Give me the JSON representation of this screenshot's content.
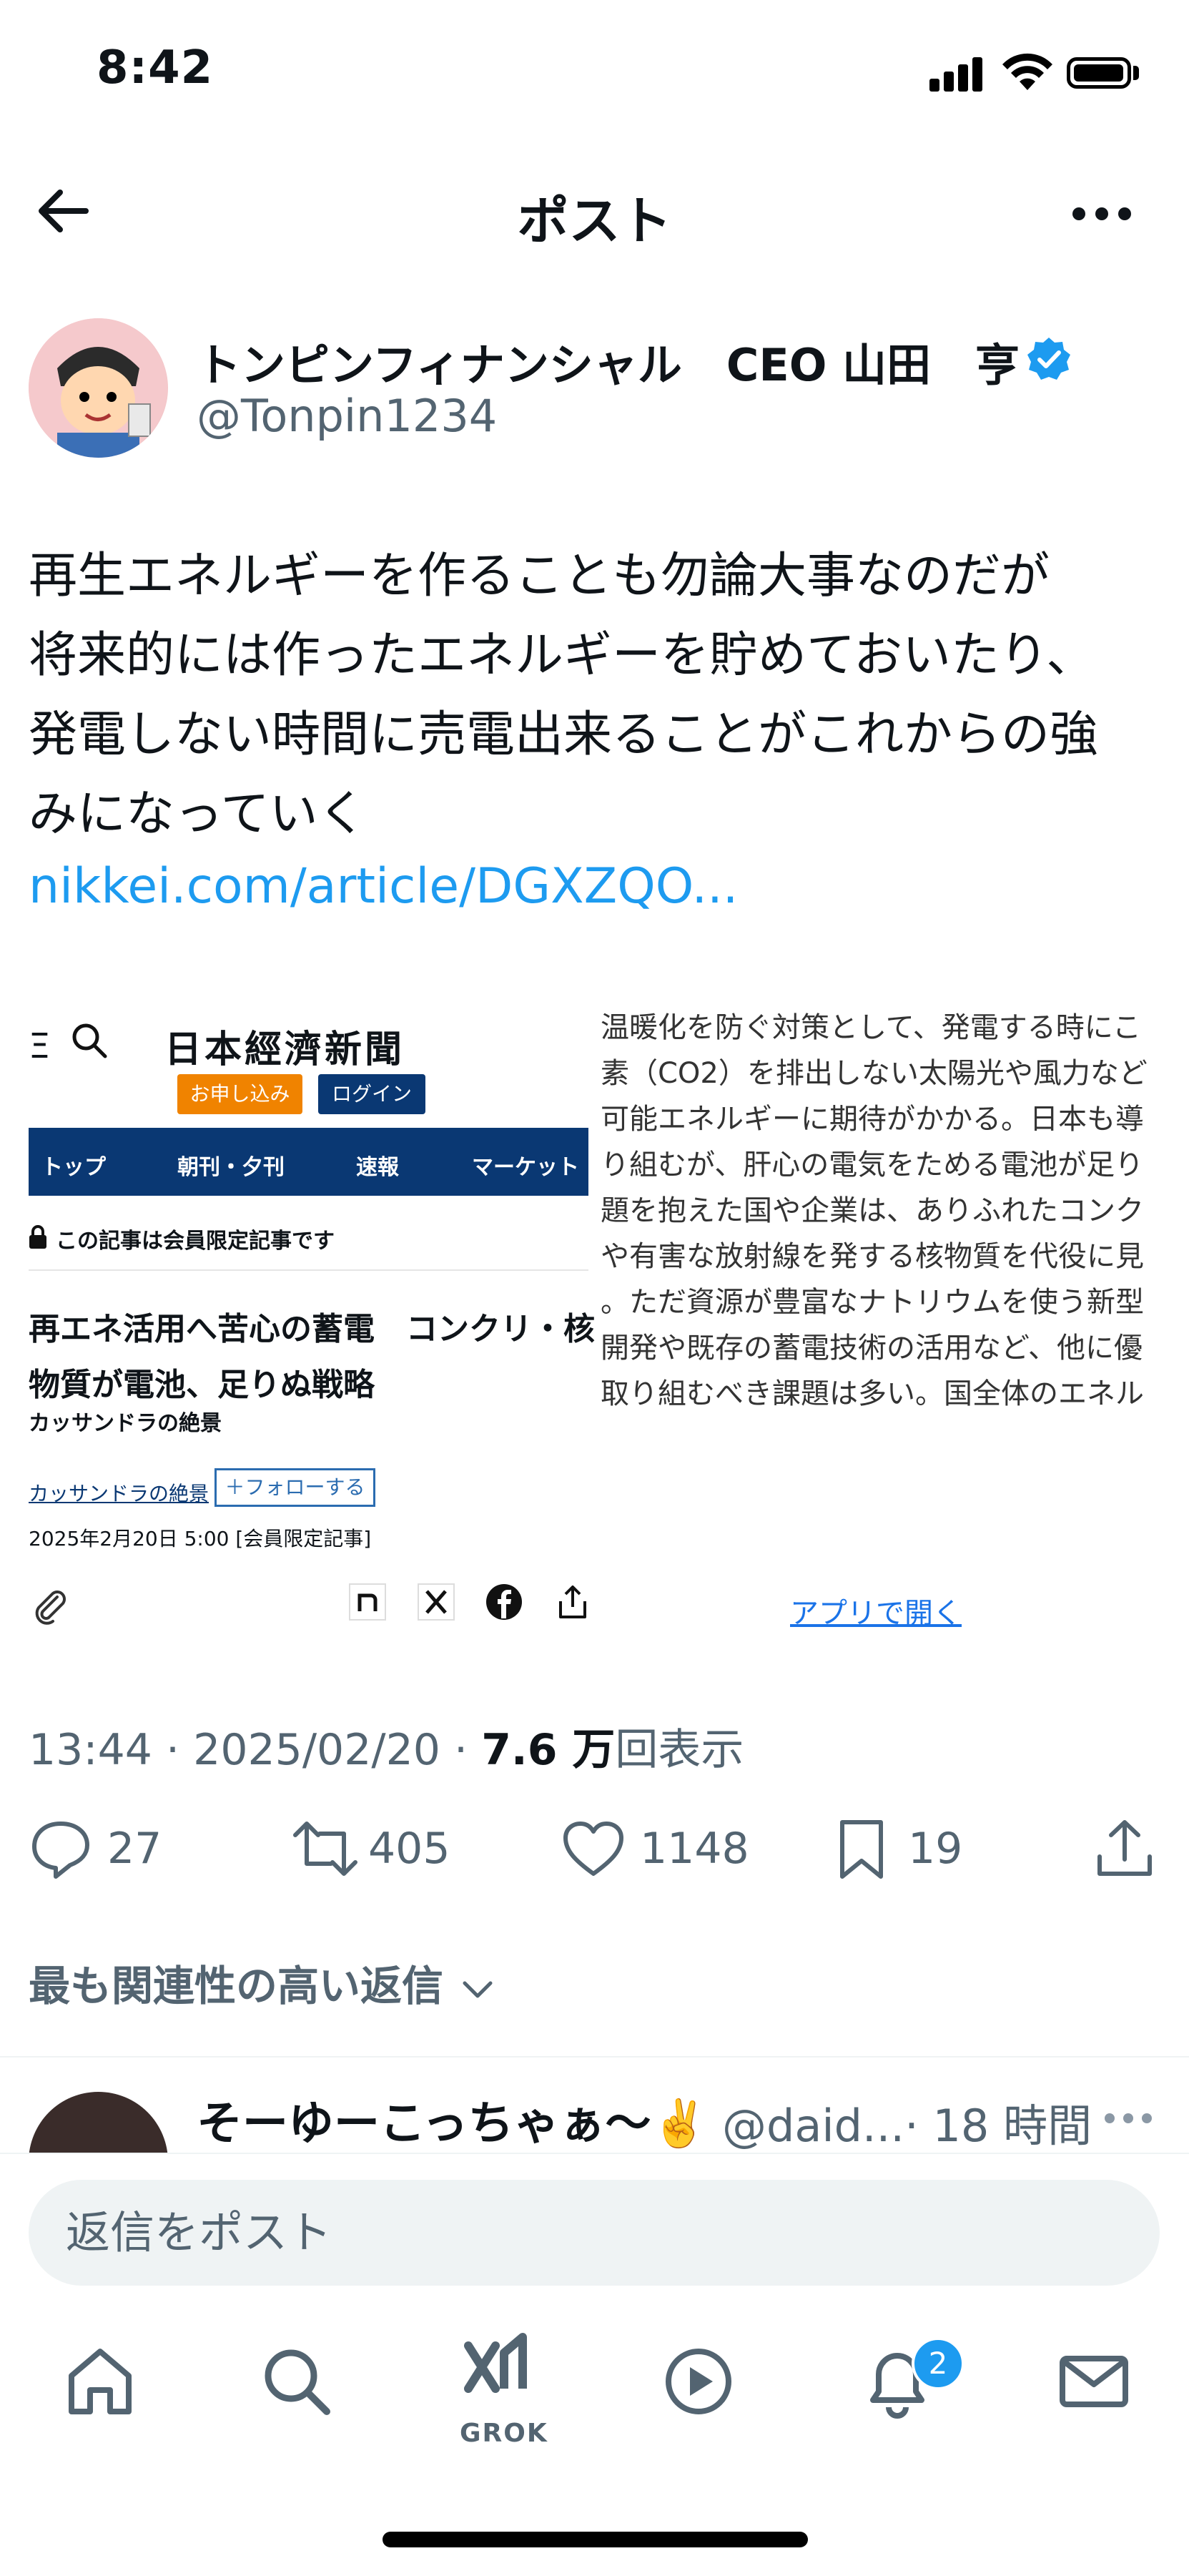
{
  "status": {
    "time": "8:42"
  },
  "header": {
    "title": "ポスト",
    "back_icon": "arrow-left-icon",
    "more_icon": "ellipsis-icon"
  },
  "author": {
    "name": "トンピンフィナンシャル　CEO 山田　亨",
    "handle": "@Tonpin1234",
    "verified_color": "#1d9bf0"
  },
  "post": {
    "text": "再生エネルギーを作ることも勿論大事なのだが\n将来的には作ったエネルギーを貯めておいたり、\n発電しない時間に売電出来ることがこれからの強\nみになっていく",
    "link": "nikkei.com/article/DGXZQO...",
    "time": "13:44",
    "date": "2025/02/20",
    "views_count": "7.6 万",
    "views_label": "回表示"
  },
  "card": {
    "menu": "Ξ",
    "logo": "日本經濟新聞",
    "signup": "お申し込み",
    "login": "ログイン",
    "nav": [
      "トップ",
      "朝刊・夕刊",
      "速報",
      "マーケット"
    ],
    "member_only": "この記事は会員限定記事です",
    "headline": "再エネ活用へ苦心の蓄電　コンクリ・核\n物質が電池、足りぬ戦略",
    "series": "カッサンドラの絶景",
    "series_link": "カッサンドラの絶景",
    "follow": "＋フォローする",
    "date": "2025年2月20日 5:00 [会員限定記事]",
    "body": "温暖化を防ぐ対策として、発電する時にこ\n素（CO2）を排出しない太陽光や風力など\n可能エネルギーに期待がかかる。日本も導\nり組むが、肝心の電気をためる電池が足り\n題を抱えた国や企業は、ありふれたコンク\nや有害な放射線を発する核物質を代役に見\n。ただ資源が豊富なナトリウムを使う新型\n開発や既存の蓄電技術の活用など、他に優\n取り組むべき課題は多い。国全体のエネル",
    "open_app": "アプリで開く",
    "share_icons": [
      "note-icon",
      "x-icon",
      "facebook-icon",
      "share-icon"
    ]
  },
  "actions": {
    "replies": "27",
    "reposts": "405",
    "likes": "1148",
    "bookmarks": "19"
  },
  "relevance": "最も関連性の高い返信",
  "reply": {
    "name": "そーゆーこっちゃぁ〜✌️",
    "handle": "@daid...",
    "time": "· 18 時間"
  },
  "compose": {
    "placeholder": "返信をポスト"
  },
  "tabs": {
    "grok_label": "GROK",
    "notifications_badge": "2"
  }
}
